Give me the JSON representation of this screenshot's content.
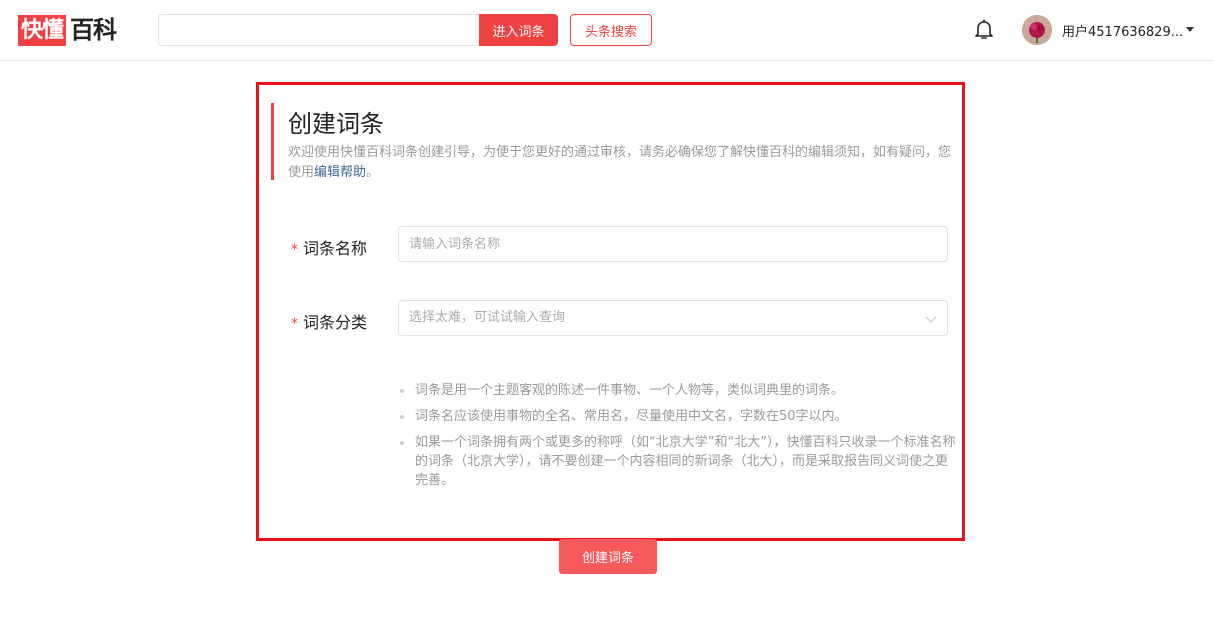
{
  "logo": {
    "box_text": "快懂",
    "text": "百科"
  },
  "search": {
    "placeholder": "",
    "value": "",
    "enter_label": "进入词条",
    "toutiao_label": "头条搜索"
  },
  "user": {
    "name": "用户4517636829..."
  },
  "form": {
    "title": "创建词条",
    "intro_text": "欢迎使用快懂百科词条创建引导，为便于您更好的通过审核，请务必确保您了解快懂百科的编辑须知，如有疑问，您使用",
    "intro_link": "编辑帮助",
    "intro_end": "。",
    "required_mark": "*",
    "name_label": "词条名称",
    "name_placeholder": "请输入词条名称",
    "category_label": "词条分类",
    "category_placeholder": "选择太难，可试试输入查询",
    "tips": [
      "词条是用一个主题客观的陈述一件事物、一个人物等，类似词典里的词条。",
      "词条名应该使用事物的全名、常用名，尽量使用中文名，字数在50字以内。",
      "如果一个词条拥有两个或更多的称呼（如“北京大学”和“北大”），快懂百科只收录一个标准名称的词条（北京大学），请不要创建一个内容相同的新词条（北大），而是采取报告同义词使之更完善。"
    ],
    "submit_label": "创建词条"
  },
  "colors": {
    "brand": "#f04142",
    "highlight_border": "#e8101a",
    "submit": "#f8595a",
    "link": "#406599"
  }
}
